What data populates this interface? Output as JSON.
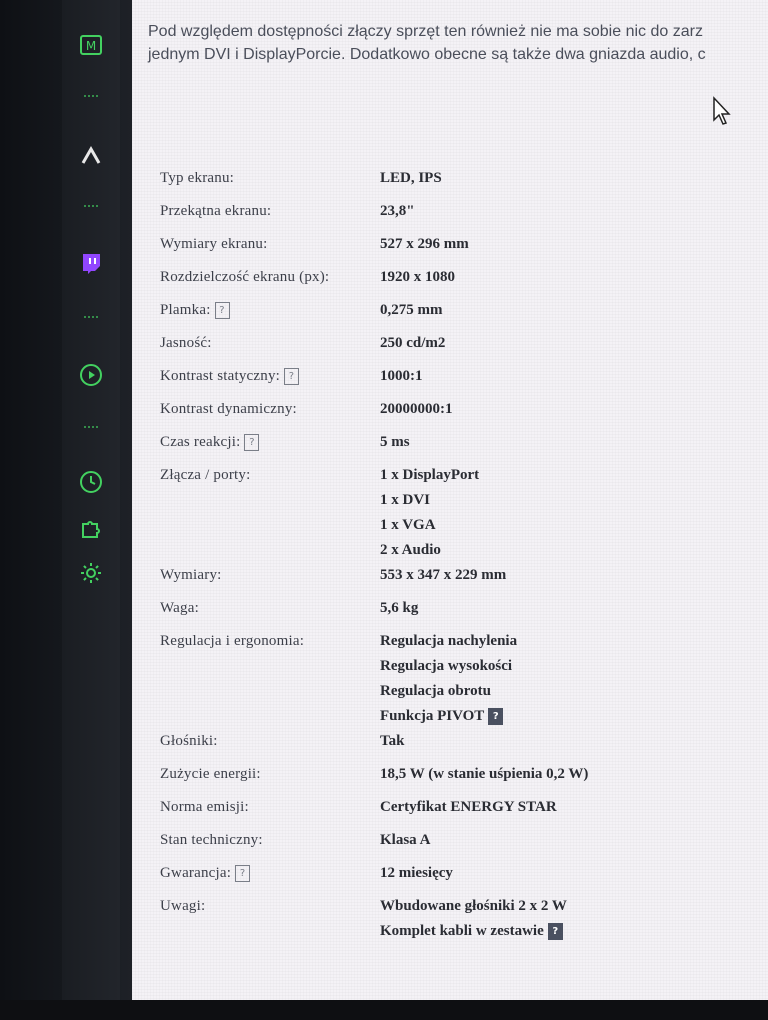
{
  "sidebar": {
    "icons": [
      {
        "name": "m-icon",
        "glyph": "M"
      },
      {
        "name": "arrow-up-icon"
      },
      {
        "name": "twitch-icon"
      },
      {
        "name": "play-circle-icon"
      },
      {
        "name": "clock-icon"
      },
      {
        "name": "puzzle-icon"
      },
      {
        "name": "gear-icon"
      }
    ],
    "accent": "#43d160"
  },
  "intro": {
    "line1": "Pod względem dostępności złączy sprzęt ten również nie ma sobie nic do zarz",
    "line2": "jednym DVI i DisplayPorcie. Dodatkowo obecne są także dwa gniazda audio, c"
  },
  "help_glyph": "?",
  "specs": [
    {
      "label": "Typ ekranu:",
      "values": [
        "LED, IPS"
      ]
    },
    {
      "label": "Przekątna ekranu:",
      "values": [
        "23,8\""
      ]
    },
    {
      "label": "Wymiary ekranu:",
      "values": [
        "527 x 296 mm"
      ]
    },
    {
      "label": "Rozdzielczość ekranu (px):",
      "values": [
        "1920 x 1080"
      ]
    },
    {
      "label": "Plamka:",
      "help": true,
      "values": [
        "0,275 mm"
      ]
    },
    {
      "label": "Jasność:",
      "values": [
        "250 cd/m2"
      ]
    },
    {
      "label": "Kontrast statyczny:",
      "help": true,
      "values": [
        "1000:1"
      ]
    },
    {
      "label": "Kontrast dynamiczny:",
      "values": [
        "20000000:1"
      ]
    },
    {
      "label": "Czas reakcji:",
      "help": true,
      "values": [
        "5 ms"
      ]
    },
    {
      "label": "Złącza / porty:",
      "values": [
        "1 x DisplayPort",
        "1 x DVI",
        "1 x VGA",
        "2 x Audio"
      ]
    },
    {
      "label": "Wymiary:",
      "values": [
        "553 x 347 x 229 mm"
      ]
    },
    {
      "label": "Waga:",
      "values": [
        "5,6 kg"
      ]
    },
    {
      "label": "Regulacja i ergonomia:",
      "values": [
        "Regulacja nachylenia",
        "Regulacja wysokości",
        "Regulacja obrotu",
        "Funkcja PIVOT"
      ],
      "value_help_last": true
    },
    {
      "label": "Głośniki:",
      "values": [
        "Tak"
      ]
    },
    {
      "label": "Zużycie energii:",
      "values": [
        "18,5 W (w stanie uśpienia 0,2 W)"
      ]
    },
    {
      "label": "Norma emisji:",
      "values": [
        "Certyfikat ENERGY STAR"
      ]
    },
    {
      "label": "Stan techniczny:",
      "values": [
        "Klasa A"
      ]
    },
    {
      "label": "Gwarancja:",
      "help": true,
      "values": [
        "12 miesięcy"
      ]
    },
    {
      "label": "Uwagi:",
      "values": [
        "Wbudowane głośniki 2 x 2 W",
        "Komplet kabli w zestawie"
      ],
      "value_help_last": true
    }
  ]
}
